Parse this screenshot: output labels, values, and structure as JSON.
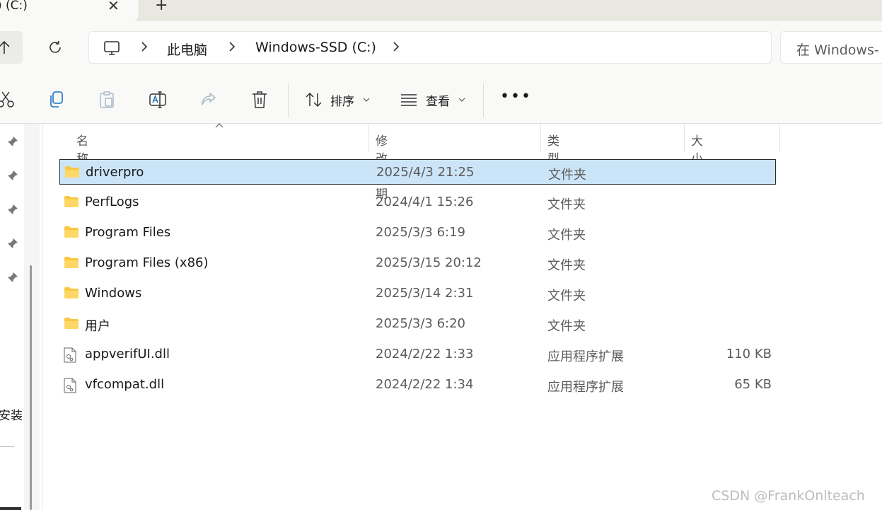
{
  "tab": {
    "title": ") (C:)",
    "close": "✕",
    "new": "+"
  },
  "address": {
    "crumbs": [
      "此电脑",
      "Windows-SSD (C:)"
    ],
    "search_placeholder": "在 Windows-"
  },
  "toolbar": {
    "sort_label": "排序",
    "view_label": "查看",
    "more_label": "•••"
  },
  "nav": {
    "partial_label": "安装"
  },
  "columns": {
    "name": "名称",
    "date": "修改日期",
    "type": "类型",
    "size": "大小"
  },
  "files": [
    {
      "name": "driverpro",
      "date": "2025/4/3 21:25",
      "type": "文件夹",
      "size": "",
      "icon": "folder-icon",
      "selected": true
    },
    {
      "name": "PerfLogs",
      "date": "2024/4/1 15:26",
      "type": "文件夹",
      "size": "",
      "icon": "folder-icon"
    },
    {
      "name": "Program Files",
      "date": "2025/3/3 6:19",
      "type": "文件夹",
      "size": "",
      "icon": "folder-icon"
    },
    {
      "name": "Program Files (x86)",
      "date": "2025/3/15 20:12",
      "type": "文件夹",
      "size": "",
      "icon": "folder-icon"
    },
    {
      "name": "Windows",
      "date": "2025/3/14 2:31",
      "type": "文件夹",
      "size": "",
      "icon": "folder-icon"
    },
    {
      "name": "用户",
      "date": "2025/3/3 6:20",
      "type": "文件夹",
      "size": "",
      "icon": "folder-icon"
    },
    {
      "name": "appverifUI.dll",
      "date": "2024/2/22 1:33",
      "type": "应用程序扩展",
      "size": "110 KB",
      "icon": "dll-file-icon"
    },
    {
      "name": "vfcompat.dll",
      "date": "2024/2/22 1:34",
      "type": "应用程序扩展",
      "size": "65 KB",
      "icon": "dll-file-icon"
    }
  ],
  "watermark": "CSDN @FrankOnlteach",
  "colors": {
    "selection": "#cce4f7",
    "folder": "#f8c843",
    "chrome": "#f9f9f7"
  }
}
